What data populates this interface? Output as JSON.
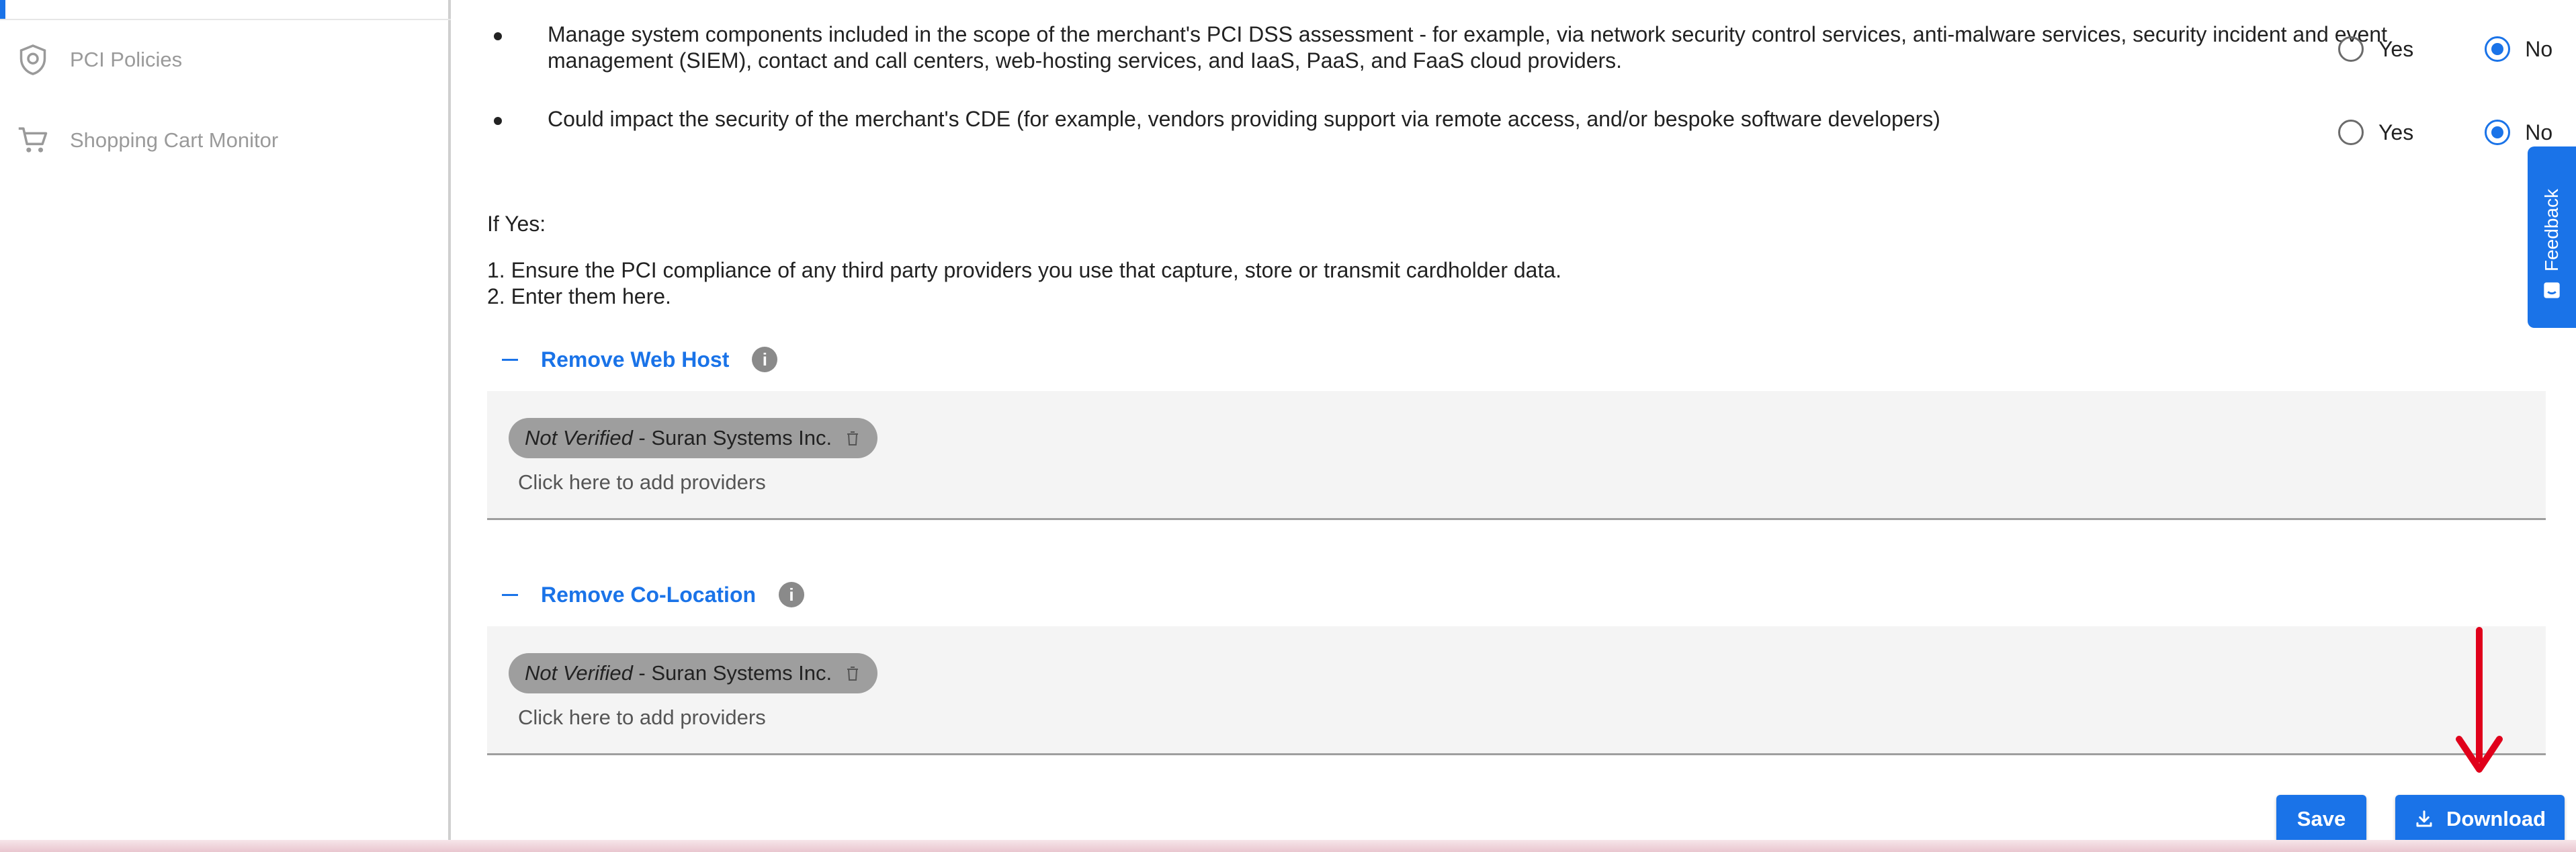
{
  "sidebar": {
    "items": [
      {
        "label": "PCI Policies",
        "icon": "shield-icon"
      },
      {
        "label": "Shopping Cart Monitor",
        "icon": "cart-icon"
      }
    ]
  },
  "questions": [
    {
      "text": "Manage system components included in the scope of the merchant's PCI DSS assessment - for example, via network security control services, anti-malware services, security incident and event management (SIEM), contact and call centers, web-hosting services, and IaaS, PaaS, and FaaS cloud providers.",
      "yes_label": "Yes",
      "no_label": "No",
      "selected": "No"
    },
    {
      "text": "Could impact the security of the merchant's CDE (for example, vendors providing support via remote access, and/or bespoke software developers)",
      "yes_label": "Yes",
      "no_label": "No",
      "selected": "No"
    }
  ],
  "instructions": {
    "if_yes": "If Yes:",
    "step1": "1. Ensure the PCI compliance of any third party providers you use that capture, store or transmit cardholder data.",
    "step2": "2. Enter them here."
  },
  "sections": [
    {
      "title": "Remove Web Host",
      "chip_status": "Not Verified",
      "chip_separator": " - ",
      "chip_name": "Suran Systems Inc.",
      "add_placeholder": "Click here to add providers"
    },
    {
      "title": "Remove Co-Location",
      "chip_status": "Not Verified",
      "chip_separator": " - ",
      "chip_name": "Suran Systems Inc.",
      "add_placeholder": "Click here to add providers"
    }
  ],
  "footer": {
    "save_label": "Save",
    "download_label": "Download"
  },
  "feedback": {
    "label": "Feedback"
  },
  "colors": {
    "accent": "#1a73e8",
    "chip": "#9e9e9e",
    "annotation_arrow": "#e0001b"
  }
}
